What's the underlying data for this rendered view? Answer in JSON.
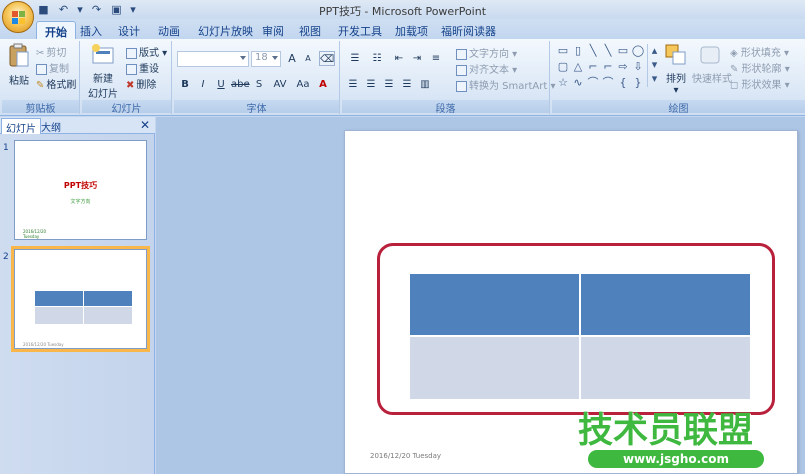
{
  "window": {
    "title": "PPT技巧 - Microsoft PowerPoint"
  },
  "tabs": [
    "开始",
    "插入",
    "设计",
    "动画",
    "幻灯片放映",
    "审阅",
    "视图",
    "开发工具",
    "加载项",
    "福昕阅读器"
  ],
  "ribbon": {
    "clipboard": {
      "label": "剪贴板",
      "paste": "粘贴",
      "cut": "剪切",
      "copy": "复制",
      "format_painter": "格式刷"
    },
    "slides": {
      "label": "幻灯片",
      "new_slide_line1": "新建",
      "new_slide_line2": "幻灯片",
      "layout": "版式",
      "reset": "重设",
      "delete": "删除"
    },
    "font": {
      "label": "字体",
      "size": "18",
      "bold": "B",
      "italic": "I",
      "underline": "U",
      "strike": "abe",
      "shadow": "S",
      "spacing": "AV",
      "case": "Aa",
      "grow": "A",
      "shrink": "A"
    },
    "paragraph": {
      "label": "段落",
      "text_direction": "文字方向",
      "align_text": "对齐文本",
      "convert_smartart": "转换为 SmartArt"
    },
    "drawing": {
      "label": "绘图",
      "arrange": "排列",
      "quick_styles": "快速样式",
      "shape_fill": "形状填充",
      "shape_outline": "形状轮廓",
      "shape_effects": "形状效果"
    }
  },
  "left_pane": {
    "tab_slides": "幻灯片",
    "tab_outline": "大纲",
    "close": "✕",
    "slides": [
      {
        "number": "1",
        "title": "PPT技巧",
        "subtitle": "文字方向",
        "footer_date": "2016/12/20",
        "footer_day": "Tuesday"
      },
      {
        "number": "2",
        "footer_date": "2016/12/20 Tuesday"
      }
    ]
  },
  "slide": {
    "footer_date": "2016/12/20  Tuesday",
    "table": {
      "rows": 2,
      "cols": 2,
      "header_color": "#4f81bd",
      "body_color": "#d0d8e8"
    }
  },
  "watermark": {
    "text": "技术员联盟",
    "url": "www.jsgho.com"
  },
  "colors": {
    "highlight_ring": "#b8203b",
    "selected_thumb": "#f9b64a"
  }
}
